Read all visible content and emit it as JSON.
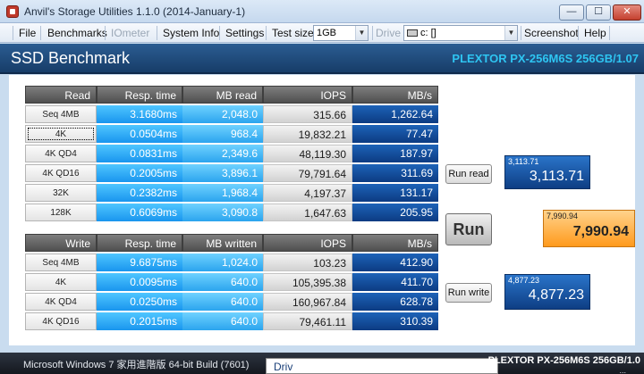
{
  "window": {
    "title": "Anvil's Storage Utilities 1.1.0 (2014-January-1)",
    "min_symbol": "—",
    "max_symbol": "☐",
    "close_symbol": "✕"
  },
  "menu": {
    "file": "File",
    "benchmarks": "Benchmarks",
    "iometer": "IOmeter",
    "system_info": "System Info",
    "settings": "Settings",
    "test_size_label": "Test size",
    "test_size_value": "1GB",
    "drive_label": "Drive",
    "drive_value": "c: []",
    "screenshot": "Screenshot",
    "help": "Help"
  },
  "header": {
    "title": "SSD Benchmark",
    "device": "PLEXTOR PX-256M6S 256GB/1.07"
  },
  "read_table": {
    "headers": [
      "Read",
      "Resp. time",
      "MB read",
      "IOPS",
      "MB/s"
    ],
    "rows": [
      {
        "label": "Seq 4MB",
        "resp": "3.1680ms",
        "mb": "2,048.0",
        "iops": "315.66",
        "mbs": "1,262.64"
      },
      {
        "label": "4K",
        "resp": "0.0504ms",
        "mb": "968.4",
        "iops": "19,832.21",
        "mbs": "77.47"
      },
      {
        "label": "4K QD4",
        "resp": "0.0831ms",
        "mb": "2,349.6",
        "iops": "48,119.30",
        "mbs": "187.97"
      },
      {
        "label": "4K QD16",
        "resp": "0.2005ms",
        "mb": "3,896.1",
        "iops": "79,791.64",
        "mbs": "311.69"
      },
      {
        "label": "32K",
        "resp": "0.2382ms",
        "mb": "1,968.4",
        "iops": "4,197.37",
        "mbs": "131.17"
      },
      {
        "label": "128K",
        "resp": "0.6069ms",
        "mb": "3,090.8",
        "iops": "1,647.63",
        "mbs": "205.95"
      }
    ]
  },
  "write_table": {
    "headers": [
      "Write",
      "Resp. time",
      "MB written",
      "IOPS",
      "MB/s"
    ],
    "rows": [
      {
        "label": "Seq 4MB",
        "resp": "9.6875ms",
        "mb": "1,024.0",
        "iops": "103.23",
        "mbs": "412.90"
      },
      {
        "label": "4K",
        "resp": "0.0095ms",
        "mb": "640.0",
        "iops": "105,395.38",
        "mbs": "411.70"
      },
      {
        "label": "4K QD4",
        "resp": "0.0250ms",
        "mb": "640.0",
        "iops": "160,967.84",
        "mbs": "628.78"
      },
      {
        "label": "4K QD16",
        "resp": "0.2015ms",
        "mb": "640.0",
        "iops": "79,461.11",
        "mbs": "310.39"
      }
    ]
  },
  "buttons": {
    "run_read": "Run read",
    "run": "Run",
    "run_write": "Run write"
  },
  "scores": {
    "read_small": "3,113.71",
    "read_big": "3,113.71",
    "total_small": "7,990.94",
    "total_big": "7,990.94",
    "write_small": "4,877.23",
    "write_big": "4,877.23"
  },
  "status": {
    "os": "Microsoft Windows 7 家用進階版  64-bit Build (7601)",
    "popup": "Driv",
    "device": "PLEXTOR PX-256M6S 256GB/1.0",
    "device_sub": "..."
  }
}
